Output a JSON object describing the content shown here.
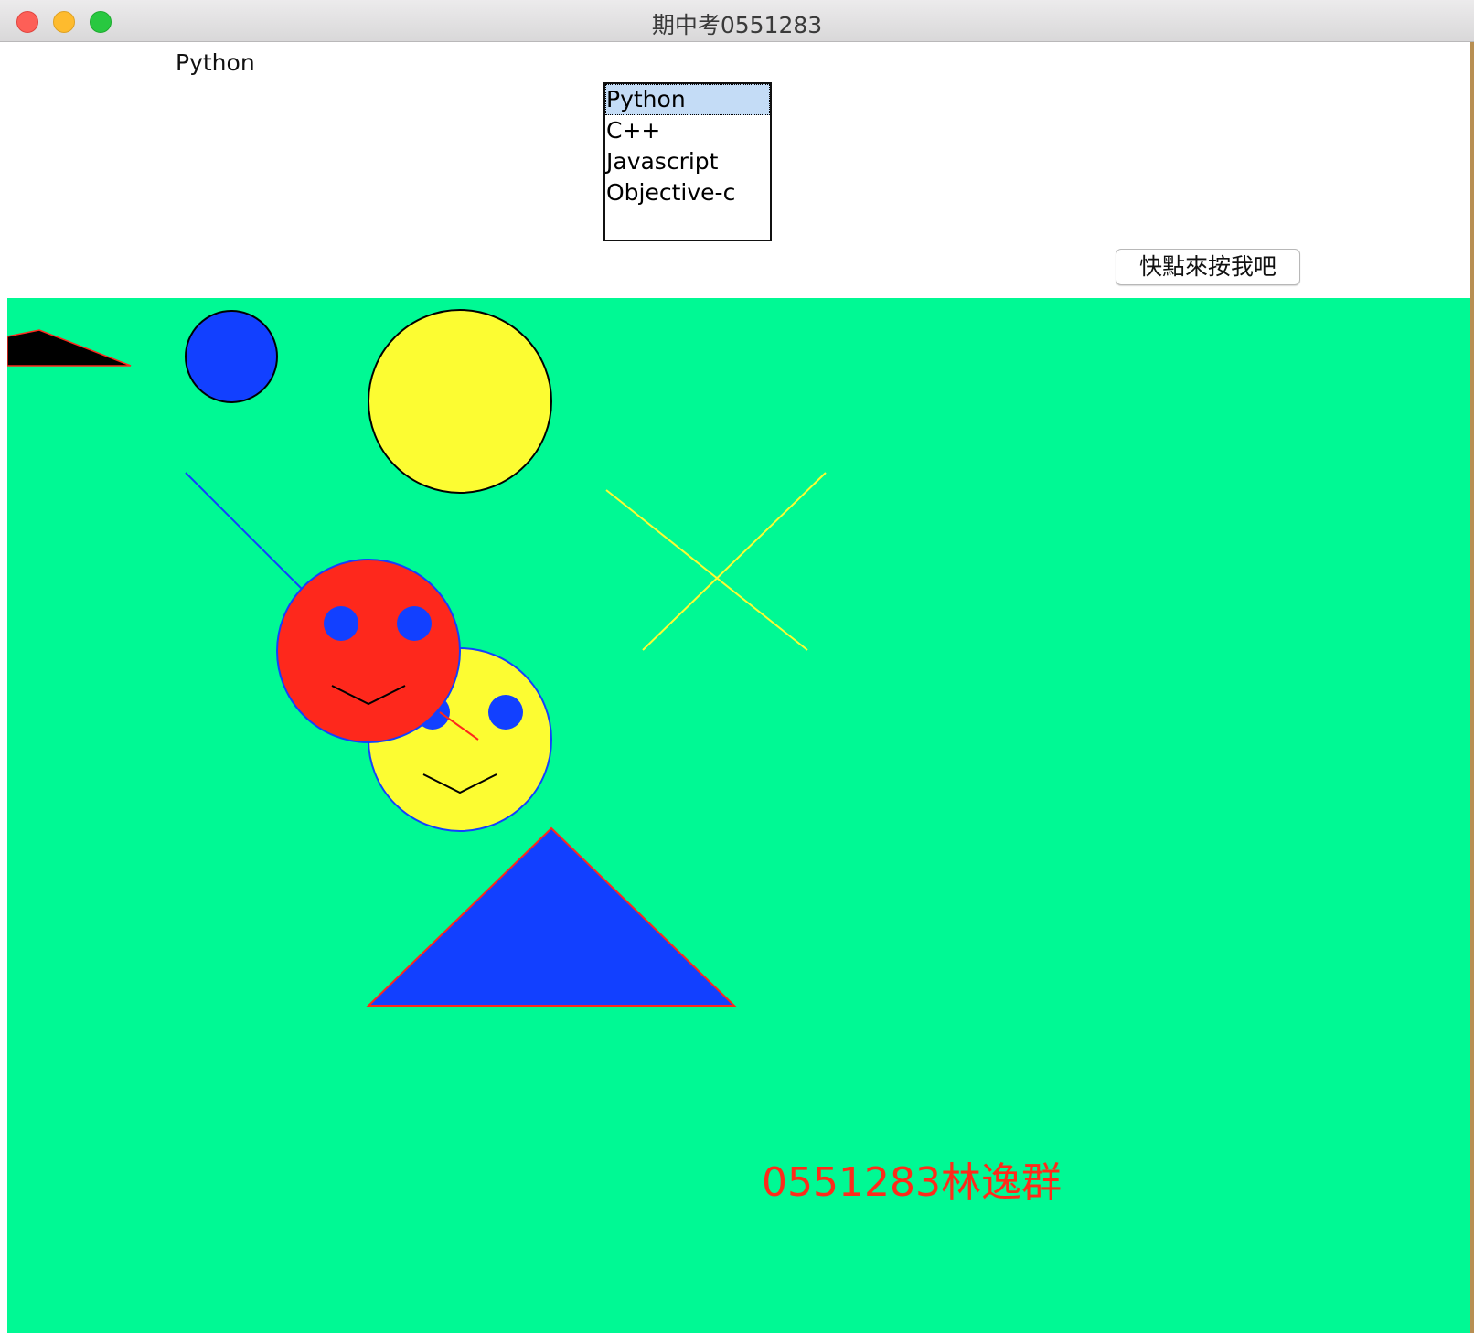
{
  "window": {
    "title": "期中考0551283"
  },
  "top_panel": {
    "selected_label": "Python",
    "listbox": {
      "items": [
        "Python",
        "C++",
        "Javascript",
        "Objective-c"
      ],
      "selected_index": 0
    },
    "button_label": "快點來按我吧"
  },
  "canvas": {
    "background": "#00f994",
    "signature_text": "0551283林逸群",
    "signature_color": "#ff2a1a"
  },
  "colors": {
    "blue": "#1240ff",
    "yellow": "#fcfc32",
    "red": "#fe281c",
    "black": "#000000"
  }
}
